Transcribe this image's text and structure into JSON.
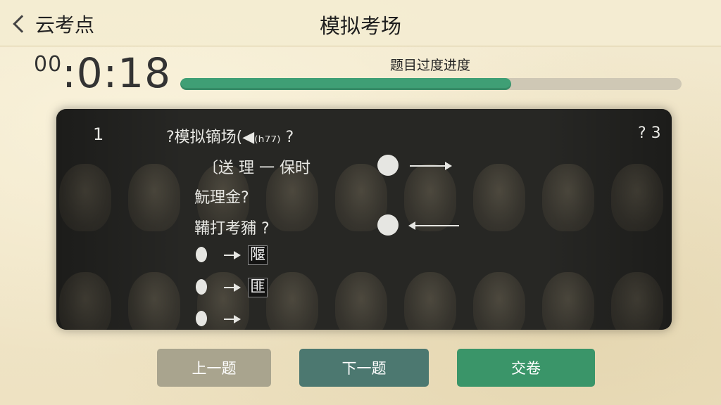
{
  "nav": {
    "back_label": "云考点",
    "title": "模拟考场"
  },
  "timer": {
    "hours": "00",
    "rest": ":0:18"
  },
  "progress": {
    "label": "题目过度进度",
    "fraction": 0.66,
    "fill_color": "#3f9f75"
  },
  "question_panel": {
    "row_number": "1",
    "header_text": "?模拟镝场(◀₍ₕ₇₇₎ ?",
    "header_right": "? 3",
    "line1": "〔送 理 一 保时",
    "line2": "魭理金?",
    "line3": "鞴打考豧 ?",
    "options": [
      {
        "label": "隁"
      },
      {
        "label": "匪"
      },
      {
        "label": ""
      }
    ]
  },
  "buttons": {
    "prev": "上一题",
    "next": "下一题",
    "submit": "交卷"
  },
  "colors": {
    "background": "#f0e6c8",
    "prev_button": "#a9a48e",
    "next_button": "#4c7870",
    "submit_button": "#3a9569"
  }
}
